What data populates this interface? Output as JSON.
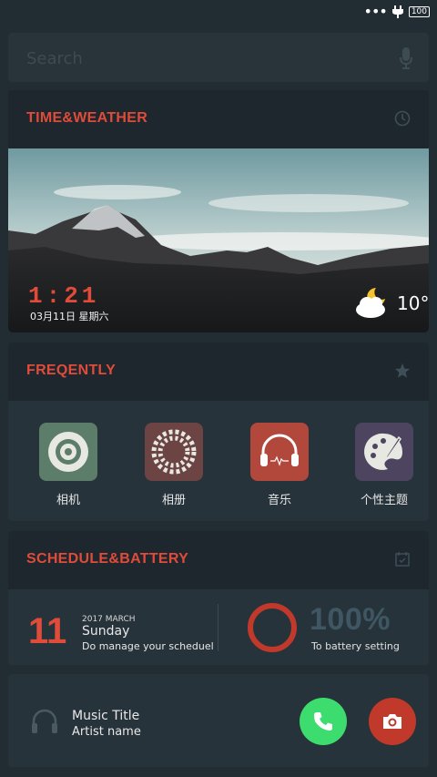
{
  "status_bar": {
    "battery_level": "100",
    "icons": [
      "more-dots-icon",
      "charging-plug-icon",
      "battery-icon"
    ]
  },
  "search": {
    "placeholder": "Search",
    "icon": "microphone-icon"
  },
  "time_weather": {
    "title": "TIME&WEATHER",
    "header_icon": "clock-icon",
    "time": "1:21",
    "date": "03月11日 星期六",
    "weather_icon": "moon-cloud-icon",
    "temperature": "10°"
  },
  "frequently": {
    "title": "FREQENTLY",
    "header_icon": "star-icon",
    "apps": [
      {
        "label": "相机",
        "icon": "camera-lens-icon",
        "color": "#5c7d6a"
      },
      {
        "label": "相册",
        "icon": "aperture-swirl-icon",
        "color": "#6b4443"
      },
      {
        "label": "音乐",
        "icon": "headphones-icon",
        "color": "#b2473b"
      },
      {
        "label": "个性主题",
        "icon": "palette-brush-icon",
        "color": "#4d4560"
      }
    ]
  },
  "schedule_battery": {
    "title": "SCHEDULE&BATTERY",
    "header_icon": "calendar-check-icon",
    "day": "11",
    "year_month": "2017 MARCH",
    "weekday": "Sunday",
    "note": "Do manage your scheduel",
    "battery_percent": "100%",
    "battery_link": "To battery setting"
  },
  "music": {
    "title": "Music Title",
    "artist": "Artist name",
    "icon": "headphones-icon",
    "call_icon": "phone-icon",
    "camera_icon": "camera-icon"
  },
  "colors": {
    "accent": "#e04b3a",
    "card": "#27333a",
    "card_header": "#1e272d",
    "background": "#222c33",
    "call": "#3ddc6e",
    "camera": "#c0392b"
  }
}
